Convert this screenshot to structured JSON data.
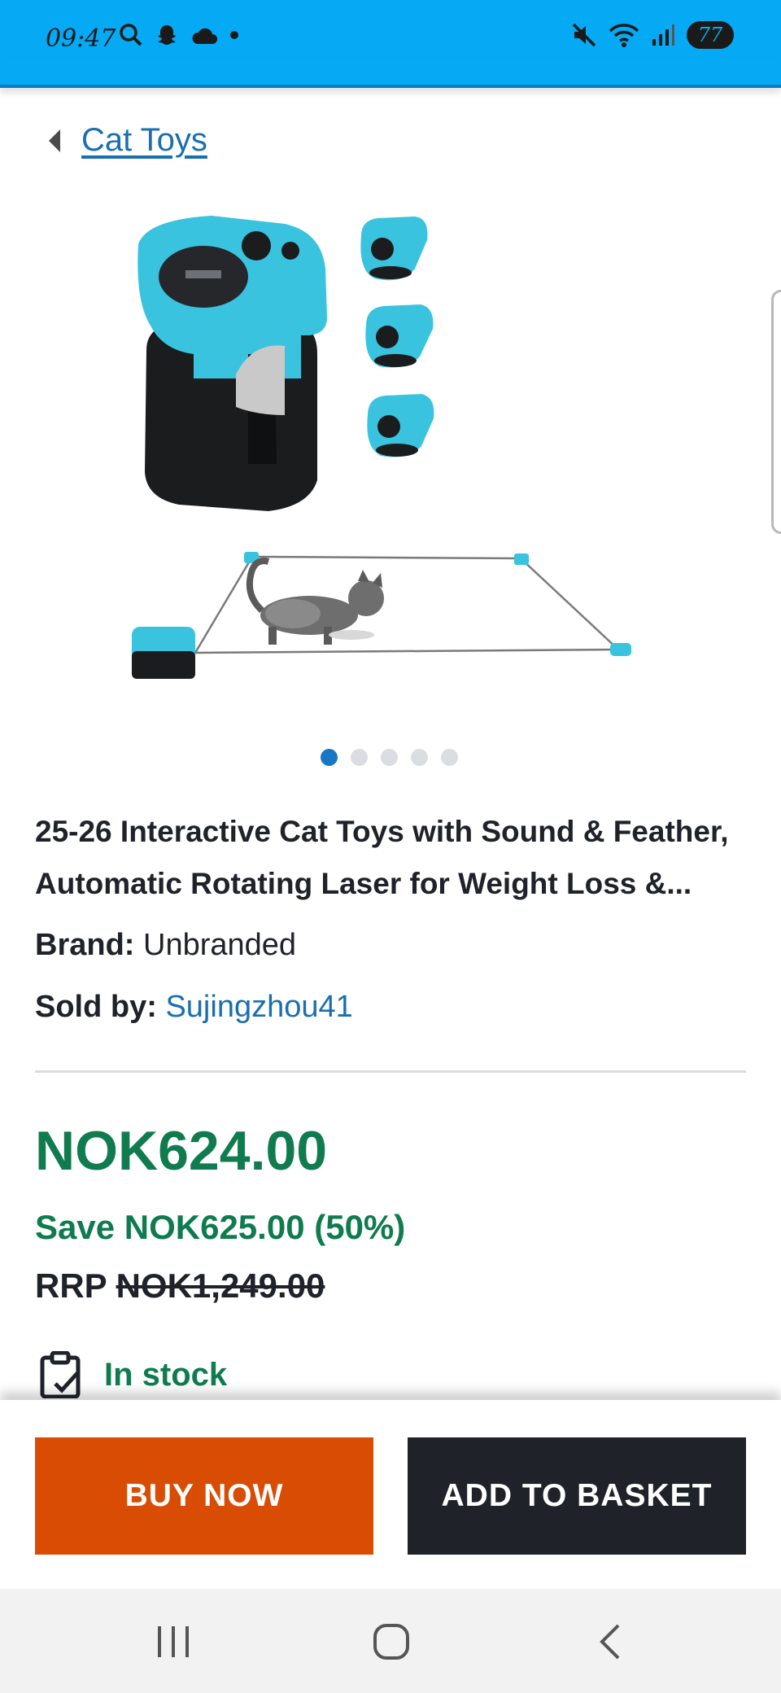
{
  "status_bar": {
    "time": "09:47",
    "battery": "77"
  },
  "breadcrumb": {
    "label": "Cat Toys"
  },
  "carousel": {
    "count": 5,
    "active_index": 0
  },
  "product": {
    "title": "25-26 Interactive Cat Toys with Sound & Feather, Automatic Rotating Laser for Weight Loss &...",
    "brand_label": "Brand:",
    "brand_value": "Unbranded",
    "seller_label": "Sold by:",
    "seller_value": "Sujingzhou41",
    "price": "NOK624.00",
    "save": "Save NOK625.00 (50%)",
    "rrp_label": "RRP",
    "rrp_value": "NOK1,249.00",
    "stock": "In stock"
  },
  "actions": {
    "buy_now": "BUY NOW",
    "add_to_basket": "ADD TO BASKET"
  },
  "colors": {
    "status_bar": "#05a9f4",
    "price_green": "#0f7b4f",
    "buy_orange": "#d94c03",
    "basket_dark": "#1f2329",
    "link_blue": "#1a6fb0"
  },
  "icons": [
    "search-icon",
    "snapchat-icon",
    "cloud-icon",
    "mute-icon",
    "wifi-icon",
    "signal-icon",
    "back-arrow-icon",
    "clipboard-check-icon",
    "recents-icon",
    "home-icon",
    "back-icon"
  ]
}
